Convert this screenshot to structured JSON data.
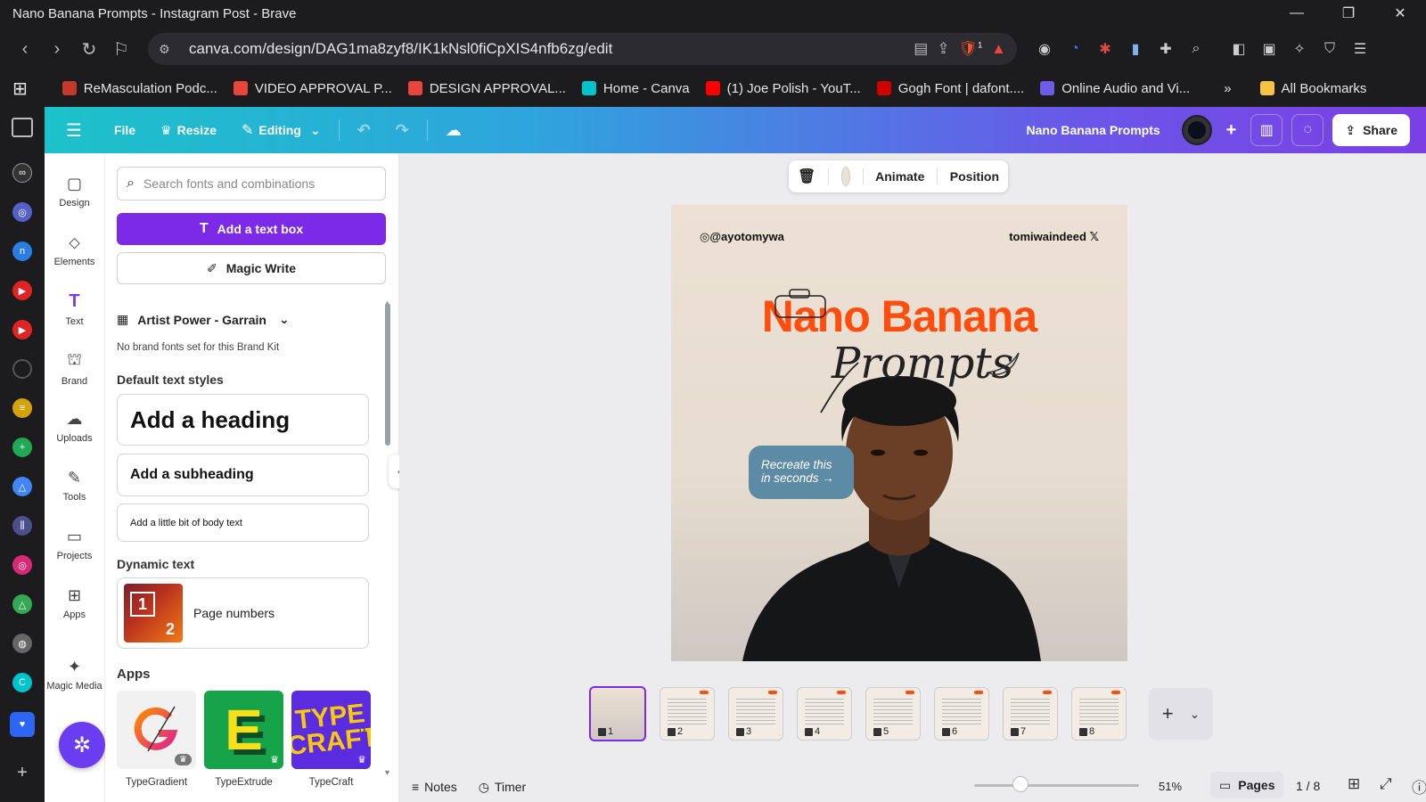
{
  "browser": {
    "window_title": "Nano Banana Prompts - Instagram Post - Brave",
    "url": "canva.com/design/DAG1ma8zyf8/IK1kNsl0fiCpXIS4nfb6zg/edit",
    "brave_badge": "1",
    "bookmarks": [
      {
        "label": "ReMasculation Podc...",
        "color": "#c0392b"
      },
      {
        "label": "VIDEO APPROVAL P...",
        "color": "#e8453c"
      },
      {
        "label": "DESIGN APPROVAL...",
        "color": "#e8453c"
      },
      {
        "label": "Home - Canva",
        "color": "#00c4cc"
      },
      {
        "label": "(1) Joe Polish - YouT...",
        "color": "#ff0000"
      },
      {
        "label": "Gogh Font | dafont....",
        "color": "#d00000"
      },
      {
        "label": "Online Audio and Vi...",
        "color": "#6c5ce7"
      }
    ],
    "bookmarks_more": "»",
    "all_bookmarks": "All Bookmarks"
  },
  "canva_top": {
    "file": "File",
    "resize": "Resize",
    "editing": "Editing",
    "design_name": "Nano Banana Prompts",
    "share": "Share"
  },
  "rail": [
    {
      "key": "design",
      "label": "Design",
      "icon": "▢"
    },
    {
      "key": "elements",
      "label": "Elements",
      "icon": "⬦"
    },
    {
      "key": "text",
      "label": "Text",
      "icon": "T"
    },
    {
      "key": "brand",
      "label": "Brand",
      "icon": "⛫"
    },
    {
      "key": "uploads",
      "label": "Uploads",
      "icon": "☁"
    },
    {
      "key": "tools",
      "label": "Tools",
      "icon": "✎"
    },
    {
      "key": "projects",
      "label": "Projects",
      "icon": "▭"
    },
    {
      "key": "apps",
      "label": "Apps",
      "icon": "⊞"
    },
    {
      "key": "magic-media",
      "label": "Magic Media",
      "icon": "✦"
    }
  ],
  "panel": {
    "search_placeholder": "Search fonts and combinations",
    "add_text_box": "Add a text box",
    "magic_write": "Magic Write",
    "brand_kit": "Artist Power - Garrain",
    "brand_note": "No brand fonts set for this Brand Kit",
    "default_styles_heading": "Default text styles",
    "heading": "Add a heading",
    "subheading": "Add a subheading",
    "body": "Add a little bit of body text",
    "dynamic_heading": "Dynamic text",
    "page_numbers": "Page numbers",
    "page_numbers_thumb_1": "1",
    "page_numbers_thumb_2": "2",
    "apps_heading": "Apps",
    "apps": [
      {
        "label": "TypeGradient"
      },
      {
        "label": "TypeExtrude"
      },
      {
        "label": "TypeCraft"
      }
    ]
  },
  "context_bar": {
    "animate": "Animate",
    "position": "Position"
  },
  "design": {
    "handle_left": "@ayotomywa",
    "handle_right": "tomiwaindeed",
    "title": "Nano Banana",
    "script": "Prompts",
    "pill_line1": "Recreate this",
    "pill_line2": "in seconds →"
  },
  "pages": [
    "1",
    "2",
    "3",
    "4",
    "5",
    "6",
    "7",
    "8"
  ],
  "bottom": {
    "notes": "Notes",
    "timer": "Timer",
    "zoom": "51%",
    "pages_label": "Pages",
    "page_count": "1 / 8"
  }
}
